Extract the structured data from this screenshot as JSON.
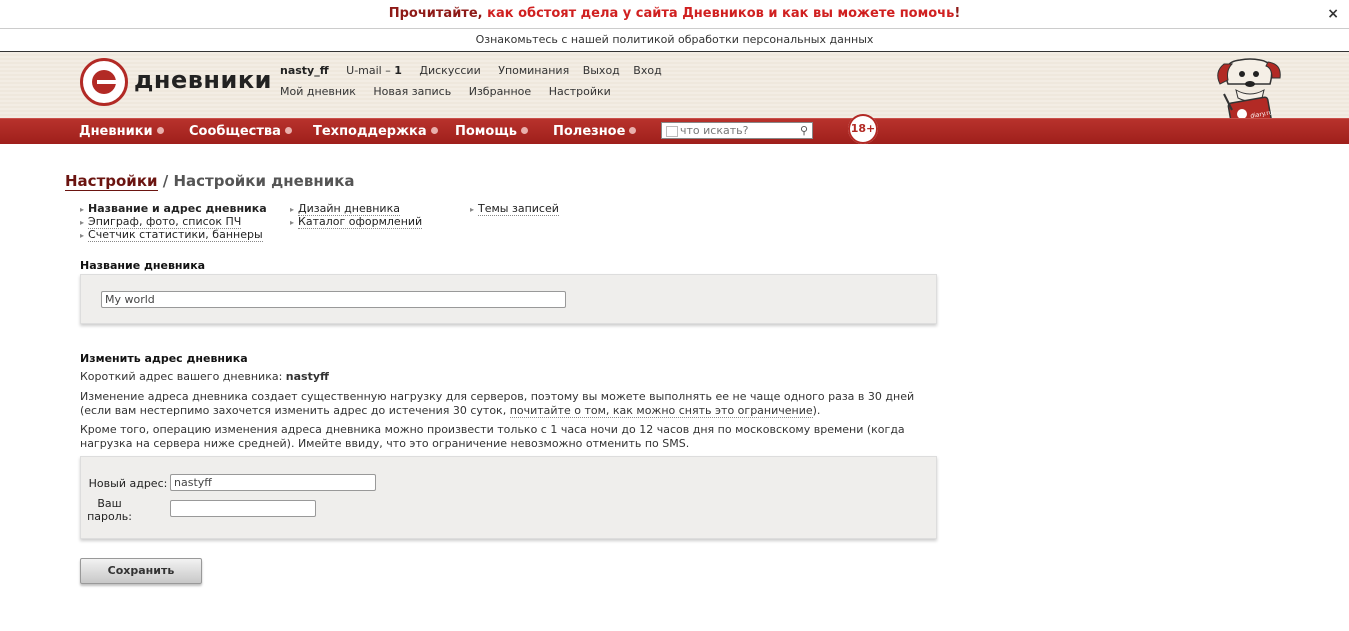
{
  "notice": {
    "prefix": "Прочитайте, ",
    "link": "как обстоят дела у сайта Дневников и как вы можете помочь",
    "suffix": "!",
    "close": "×"
  },
  "policy": "Ознакомьтесь с нашей политикой обработки персональных данных",
  "logo": {
    "text": "дневники"
  },
  "usernav": {
    "username": "nasty_ff",
    "umail": "U-mail – ",
    "umail_count": "1",
    "row1": [
      "Дискуссии",
      "Упоминания",
      "Выход",
      "Вход"
    ],
    "row2": [
      "Мой дневник",
      "Новая запись",
      "Избранное",
      "Настройки"
    ]
  },
  "mainnav": [
    "Дневники",
    "Сообщества",
    "Техподдержка",
    "Помощь",
    "Полезное"
  ],
  "search": {
    "placeholder": "что искать?"
  },
  "age_badge": "18+",
  "mascot_label": "diary.ru",
  "breadcrumb": {
    "first": "Настройки",
    "sep": " / ",
    "current": "Настройки дневника"
  },
  "subnav": {
    "col1": [
      "Название и адрес дневника",
      "Эпиграф, фото, список ПЧ",
      "Счетчик статистики, баннеры"
    ],
    "col2": [
      "Дизайн дневника",
      "Каталог оформлений"
    ],
    "col3": [
      "Темы записей"
    ]
  },
  "name_section": {
    "title": "Название дневника",
    "value": "My world"
  },
  "address_section": {
    "title": "Изменить адрес дневника",
    "short_label": "Короткий адрес вашего дневника: ",
    "short_value": "nastyff",
    "para1_a": "Изменение адреса дневника создает существенную нагрузку для серверов, поэтому вы можете выполнять ее не чаще одного раза в 30 дней (если вам нестерпимо захочется изменить адрес до истечения 30 суток, ",
    "para1_link": "почитайте о том, как можно снять это ограничение",
    "para1_b": ").",
    "para2": "Кроме того, операцию изменения адреса дневника можно произвести только с 1 часа ночи до 12 часов дня по московскому времени (когда нагрузка на сервера ниже средней). Имейте ввиду, что это ограничение невозможно отменить по SMS.",
    "new_address_label": "Новый адрес:",
    "new_address_value": "nastyff",
    "password_label": "Ваш пароль:",
    "password_value": ""
  },
  "save_button": "Сохранить",
  "colors": {
    "brand_red": "#a8251f",
    "notice_red": "#d02020"
  }
}
